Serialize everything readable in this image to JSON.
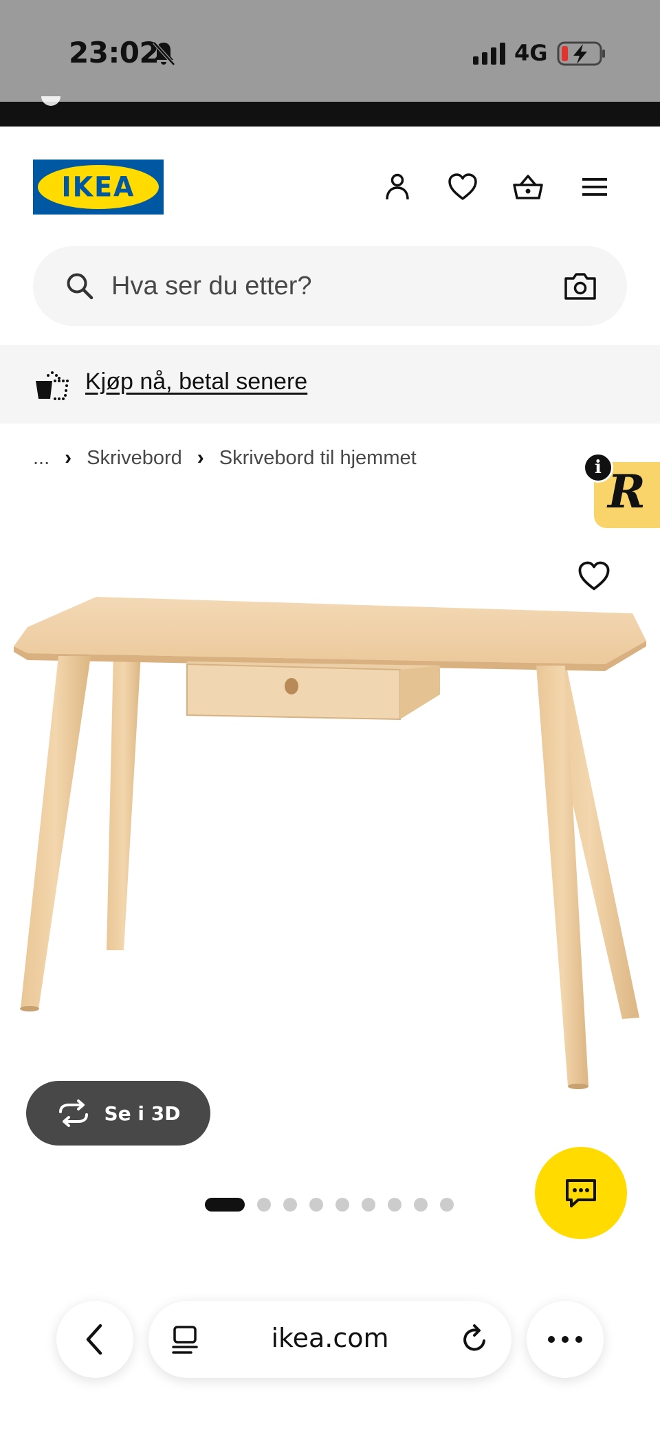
{
  "status_bar": {
    "time": "23:02",
    "network": "4G",
    "icons": [
      "bell-muted-icon",
      "signal-icon",
      "battery-charging-icon"
    ]
  },
  "header": {
    "logo_text": "IKEA",
    "icons": [
      "account-icon",
      "heart-icon",
      "cart-icon",
      "menu-icon"
    ]
  },
  "search": {
    "placeholder": "Hva ser du etter?",
    "icons": [
      "search-icon",
      "camera-icon"
    ]
  },
  "promo": {
    "link_text": "Kjøp nå, betal senere"
  },
  "breadcrumb": {
    "items": [
      "...",
      "Skrivebord",
      "Skrivebord til hjemmet"
    ]
  },
  "badge": {
    "info": "i",
    "letter": "R"
  },
  "product": {
    "see_3d_label": "Se i 3D",
    "carousel_count": 9,
    "carousel_active": 1
  },
  "browser": {
    "url": "ikea.com"
  },
  "colors": {
    "ikea_blue": "#0058a3",
    "ikea_yellow": "#ffdb00",
    "status_bar": "#9b9b9b",
    "dark_button": "#484848",
    "light_gray": "#f5f5f5"
  }
}
